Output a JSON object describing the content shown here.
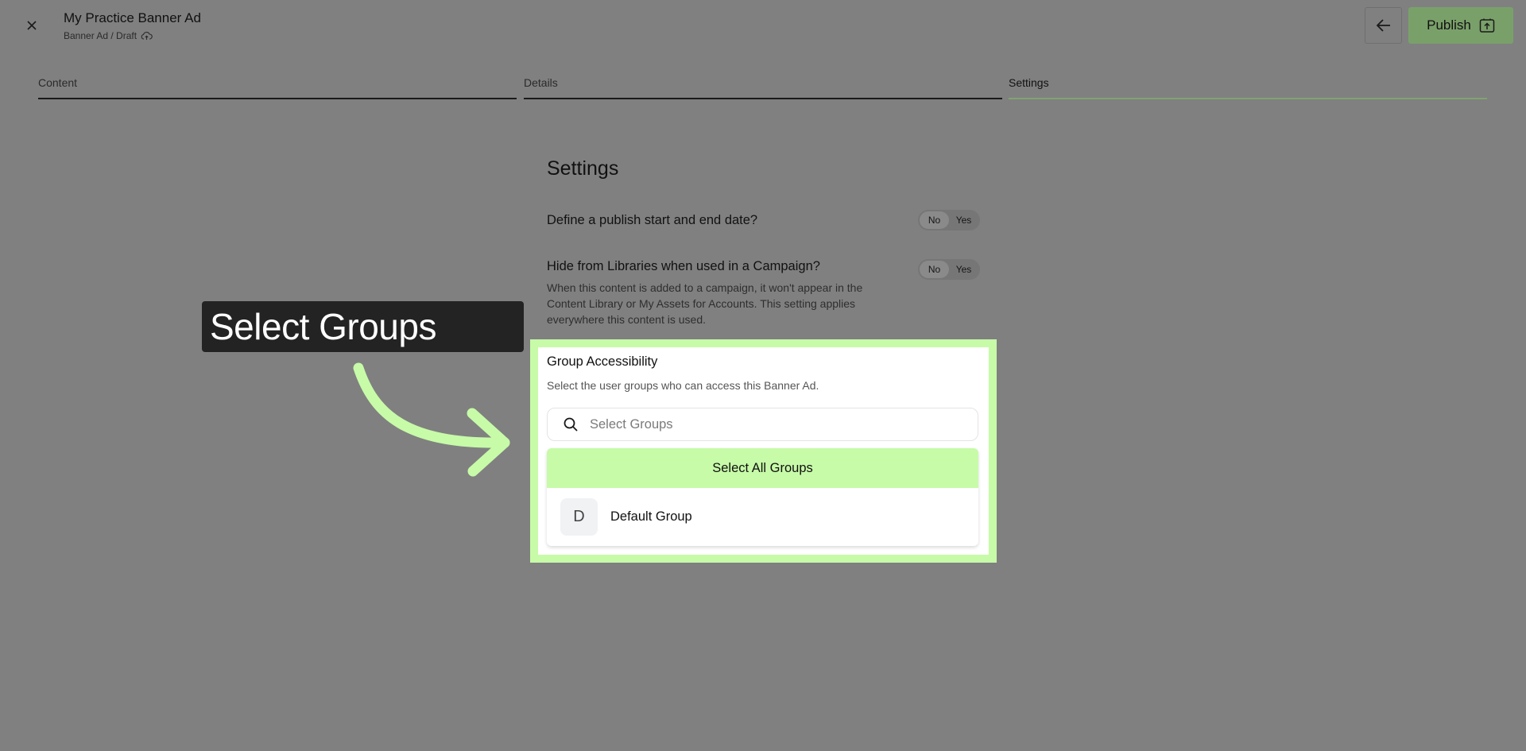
{
  "header": {
    "title": "My Practice Banner Ad",
    "subtitle": "Banner Ad / Draft",
    "close_icon": "close-icon",
    "cloud_icon": "cloud-upload-icon",
    "back_icon": "arrow-left-icon",
    "publish_label": "Publish",
    "publish_icon": "publish-icon"
  },
  "tabs": [
    {
      "label": "Content"
    },
    {
      "label": "Details"
    },
    {
      "label": "Settings",
      "active": true
    }
  ],
  "settings": {
    "heading": "Settings",
    "question1": {
      "label": "Define a publish start and end date?",
      "no": "No",
      "yes": "Yes",
      "selected": "No"
    },
    "question2": {
      "label": "Hide from Libraries when used in a Campaign?",
      "help": "When this content is added to a campaign, it won't appear in the Content Library or My Assets for Accounts. This setting applies everywhere this content is used.",
      "no": "No",
      "yes": "Yes",
      "selected": "No"
    }
  },
  "group_access": {
    "title": "Group Accessibility",
    "description": "Select the user groups who can access this Banner Ad.",
    "search_placeholder": "Select Groups",
    "search_value": "",
    "select_all_label": "Select All Groups",
    "groups": [
      {
        "initial": "D",
        "name": "Default Group"
      }
    ]
  },
  "annotation": {
    "callout_text": "Select Groups"
  },
  "colors": {
    "overlay_background": "#808080",
    "highlight": "#c7fba8",
    "publish_button": "#7aa06a",
    "callout_background": "#232323",
    "active_tab_underline": "#7fa470"
  }
}
